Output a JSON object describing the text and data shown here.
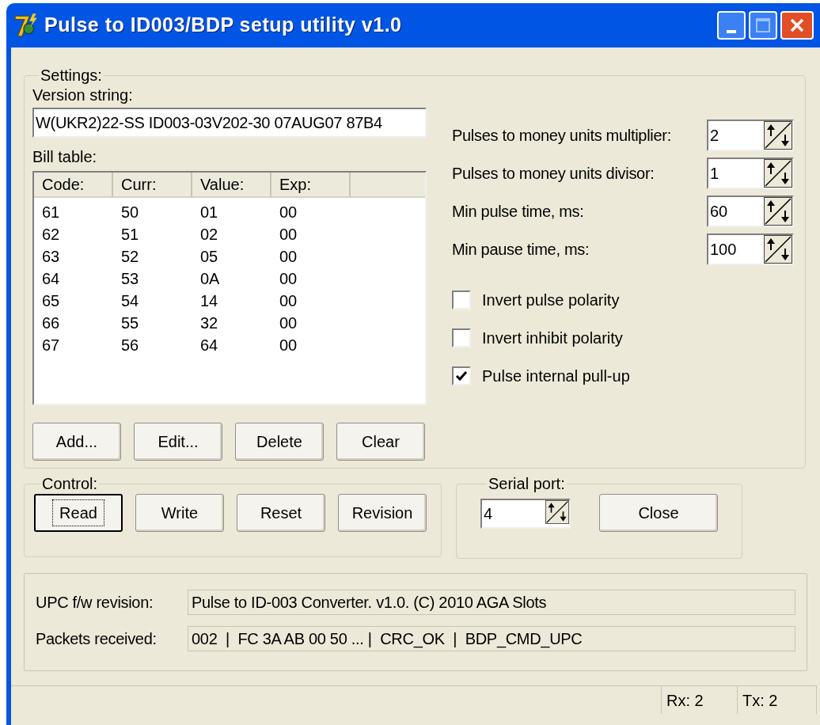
{
  "window": {
    "title": "Pulse to ID003/BDP setup utility v1.0"
  },
  "settings": {
    "title": "Settings:",
    "version_label": "Version string:",
    "version_value": "W(UKR2)22-SS ID003-03V202-30 07AUG07 87B4",
    "bill_table_label": "Bill table:",
    "bill_table": {
      "columns": [
        "Code:",
        "Curr:",
        "Value:",
        "Exp:"
      ],
      "rows": [
        [
          "61",
          "50",
          "01",
          "00"
        ],
        [
          "62",
          "51",
          "02",
          "00"
        ],
        [
          "63",
          "52",
          "05",
          "00"
        ],
        [
          "64",
          "53",
          "0A",
          "00"
        ],
        [
          "65",
          "54",
          "14",
          "00"
        ],
        [
          "66",
          "55",
          "32",
          "00"
        ],
        [
          "67",
          "56",
          "64",
          "00"
        ]
      ]
    },
    "table_buttons": [
      "Add...",
      "Edit...",
      "Delete",
      "Clear"
    ],
    "spinners": [
      {
        "label": "Pulses to money units multiplier:",
        "value": "2"
      },
      {
        "label": "Pulses to money units divisor:",
        "value": "1"
      },
      {
        "label": "Min pulse time, ms:",
        "value": "60"
      },
      {
        "label": "Min pause time, ms:",
        "value": "100"
      }
    ],
    "checkboxes": [
      {
        "label": "Invert pulse polarity",
        "checked": false
      },
      {
        "label": "Invert inhibit polarity",
        "checked": false
      },
      {
        "label": "Pulse internal pull-up",
        "checked": true
      }
    ]
  },
  "control": {
    "title": "Control:",
    "buttons": [
      {
        "label": "Read",
        "focused": true
      },
      {
        "label": "Write",
        "focused": false
      },
      {
        "label": "Reset",
        "focused": false
      },
      {
        "label": "Revision",
        "focused": false
      }
    ]
  },
  "serial_port": {
    "title": "Serial port:",
    "value": "4",
    "button": "Close"
  },
  "info": [
    {
      "label": "UPC f/w revision:",
      "value": "Pulse to ID-003 Converter. v1.0. (C) 2010 AGA Slots"
    },
    {
      "label": "Packets received:",
      "value": "002  |  FC 3A AB 00 50 ... |  CRC_OK  |  BDP_CMD_UPC"
    }
  ],
  "status_bar": [
    "Rx: 2",
    "Tx: 2"
  ]
}
